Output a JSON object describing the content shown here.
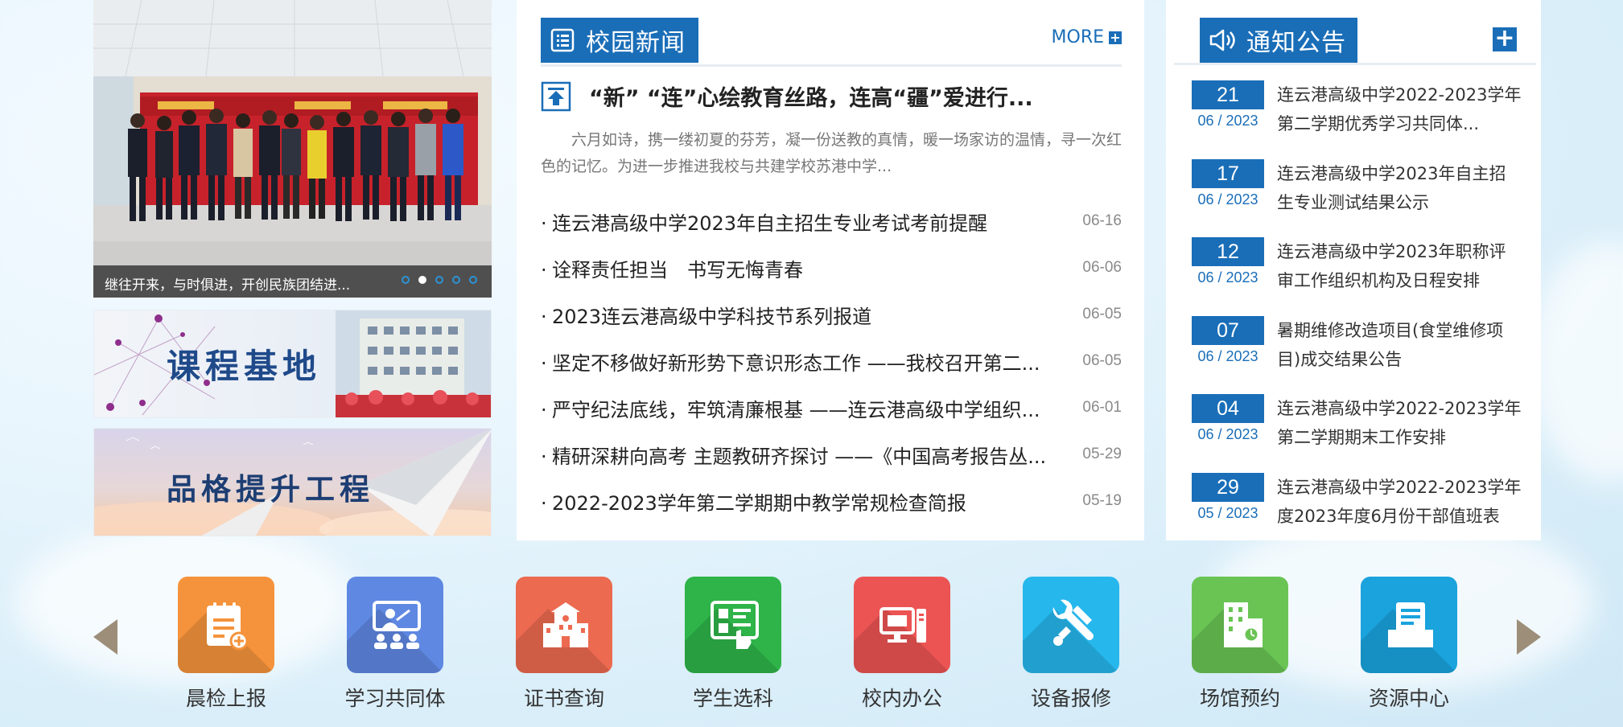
{
  "colors": {
    "primary": "#1a6eb8",
    "quick_orange": "#f5933c",
    "quick_blue": "#5f88e2",
    "quick_red_orange": "#ec6a50",
    "quick_green": "#2eb449",
    "quick_red": "#ec5454",
    "quick_cyan": "#26b7ec",
    "quick_light_green": "#69c454",
    "quick_teal": "#1aa3dd"
  },
  "slider": {
    "caption": "继往开来，与时俱进，开创民族团结进...",
    "dot_count": 5,
    "active_dot": 2
  },
  "banners": {
    "course": "课程基地",
    "quality": "品格提升工程"
  },
  "news": {
    "title": "校园新闻",
    "more": "MORE",
    "headline": "“新” “连”心绘教育丝路，连高“疆”爱进行...",
    "summary": "六月如诗，携一缕初夏的芬芳，凝一份送教的真情，暖一场家访的温情，寻一次红色的记忆。为进一步推进我校与共建学校苏港中学...",
    "items": [
      {
        "bullet": "·",
        "title": "连云港高级中学2023年自主招生专业考试考前提醒",
        "date": "06-16"
      },
      {
        "bullet": "·",
        "title": "诠释责任担当　书写无悔青春",
        "date": "06-06"
      },
      {
        "bullet": "·",
        "title": "2023连云港高级中学科技节系列报道",
        "date": "06-05"
      },
      {
        "bullet": "·",
        "title": "坚定不移做好新形势下意识形态工作 ——我校召开第二...",
        "date": "06-05"
      },
      {
        "bullet": "·",
        "title": "严守纪法底线，牢筑清廉根基 ——连云港高级中学组织...",
        "date": "06-01"
      },
      {
        "bullet": "·",
        "title": "精研深耕向高考 主题教研齐探讨 ——《中国高考报告丛...",
        "date": "05-29"
      },
      {
        "bullet": "·",
        "title": "2022-2023学年第二学期期中教学常规检查简报",
        "date": "05-19"
      }
    ]
  },
  "notices": {
    "title": "通知公告",
    "plus": "+",
    "items": [
      {
        "day": "21",
        "month": "06 / 2023",
        "text": "连云港高级中学2022-2023学年第二学期优秀学习共同体..."
      },
      {
        "day": "17",
        "month": "06 / 2023",
        "text": "连云港高级中学2023年自主招生专业测试结果公示"
      },
      {
        "day": "12",
        "month": "06 / 2023",
        "text": "连云港高级中学2023年职称评审工作组织机构及日程安排"
      },
      {
        "day": "07",
        "month": "06 / 2023",
        "text": "暑期维修改造项目(食堂维修项目)成交结果公告"
      },
      {
        "day": "04",
        "month": "06 / 2023",
        "text": "连云港高级中学2022-2023学年第二学期期末工作安排"
      },
      {
        "day": "29",
        "month": "05 / 2023",
        "text": "连云港高级中学2022-2023学年度2023年度6月份干部值班表"
      }
    ]
  },
  "quick_links": [
    {
      "label": "晨检上报",
      "icon": "clipboard-add-icon",
      "color": "#f5933c"
    },
    {
      "label": "学习共同体",
      "icon": "classroom-icon",
      "color": "#5f88e2"
    },
    {
      "label": "证书查询",
      "icon": "building-icon",
      "color": "#ec6a50"
    },
    {
      "label": "学生选科",
      "icon": "checklist-icon",
      "color": "#2eb449"
    },
    {
      "label": "校内办公",
      "icon": "computer-icon",
      "color": "#ec5454"
    },
    {
      "label": "设备报修",
      "icon": "wrench-icon",
      "color": "#26b7ec"
    },
    {
      "label": "场馆预约",
      "icon": "venue-clock-icon",
      "color": "#69c454"
    },
    {
      "label": "资源中心",
      "icon": "document-tray-icon",
      "color": "#1aa3dd"
    }
  ]
}
